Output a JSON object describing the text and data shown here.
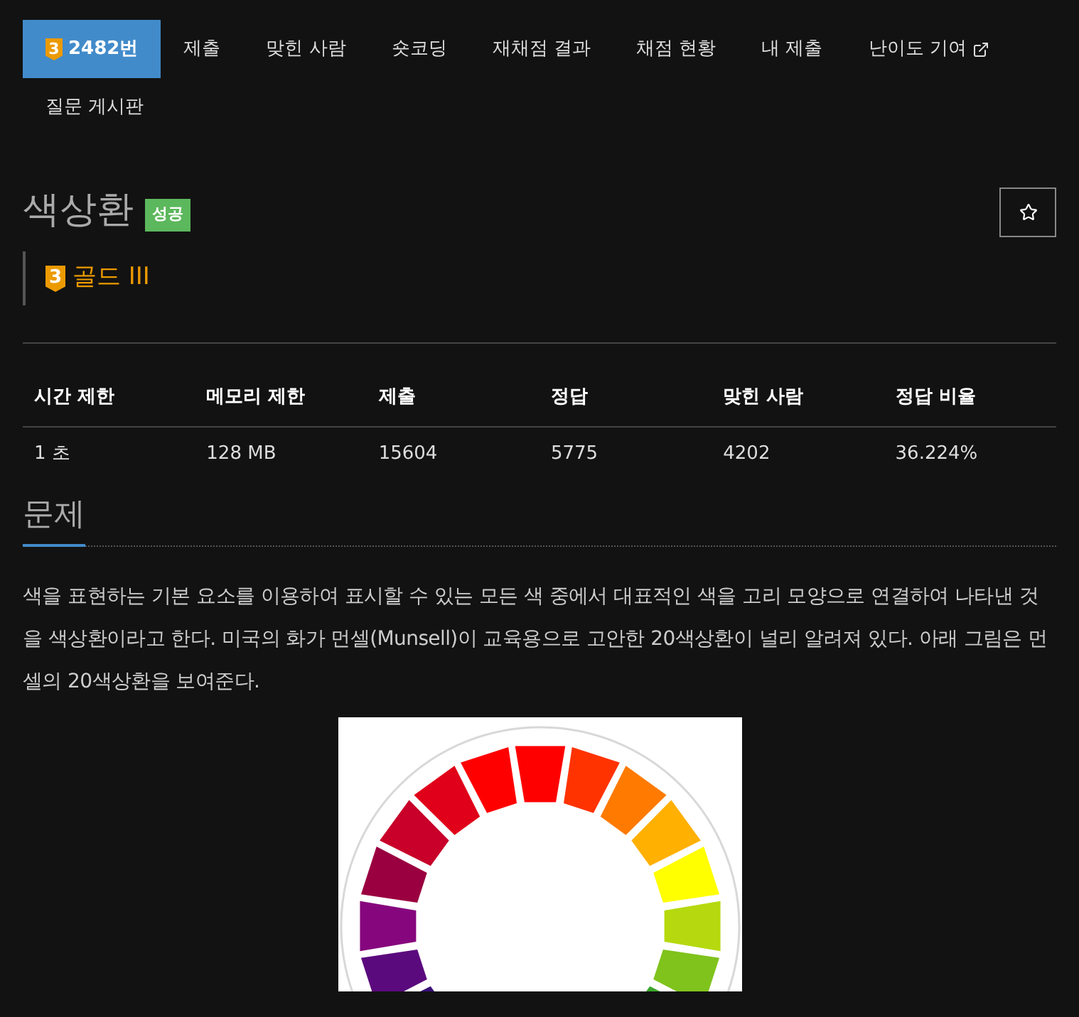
{
  "tabs": [
    {
      "label": "2482번",
      "tier_mark": "3",
      "selected": true,
      "external": false
    },
    {
      "label": "제출",
      "selected": false,
      "external": false
    },
    {
      "label": "맞힌 사람",
      "selected": false,
      "external": false
    },
    {
      "label": "숏코딩",
      "selected": false,
      "external": false
    },
    {
      "label": "재채점 결과",
      "selected": false,
      "external": false
    },
    {
      "label": "채점 현황",
      "selected": false,
      "external": false
    },
    {
      "label": "내 제출",
      "selected": false,
      "external": false
    },
    {
      "label": "난이도 기여",
      "selected": false,
      "external": true
    },
    {
      "label": "질문 게시판",
      "selected": false,
      "external": false
    }
  ],
  "problem": {
    "title": "색상환",
    "result_badge": "성공",
    "tier": {
      "mark": "3",
      "name": "골드 III"
    }
  },
  "stats": {
    "columns": [
      "시간 제한",
      "메모리 제한",
      "제출",
      "정답",
      "맞힌 사람",
      "정답 비율"
    ],
    "rows": [
      [
        "1 초",
        "128 MB",
        "15604",
        "5775",
        "4202",
        "36.224%"
      ]
    ]
  },
  "section": {
    "heading": "문제",
    "paragraphs": [
      "색을 표현하는 기본 요소를 이용하여 표시할 수 있는 모든 색 중에서 대표적인 색을 고리 모양으로 연결하여 나타낸 것을 색상환이라고 한다. 미국의 화가 먼셀(Munsell)이 교육용으로 고안한 20색상환이 널리 알려져 있다. 아래 그림은 먼셀의 20색상환을 보여준다."
    ]
  }
}
